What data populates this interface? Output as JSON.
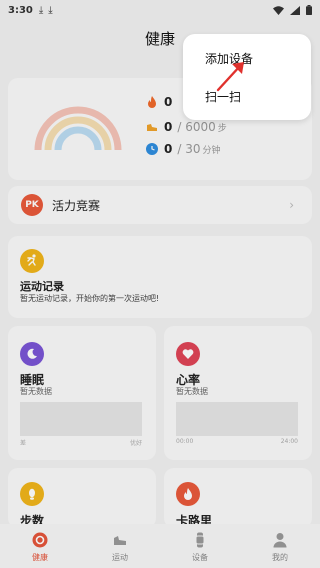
{
  "status_bar": {
    "time": "3:30",
    "download_icons": [
      "download-icon",
      "download-icon"
    ],
    "right_icons": [
      "wifi-icon",
      "signal-icon",
      "battery-icon"
    ]
  },
  "header": {
    "title": "健康"
  },
  "stats": {
    "calories": {
      "value": "0",
      "goal": "",
      "icon": "flame-icon",
      "color": "#f06a2b"
    },
    "steps": {
      "value": "0",
      "goal": "6000",
      "unit": "步",
      "icon": "shoe-icon",
      "color": "#f0a32b"
    },
    "active": {
      "value": "0",
      "goal": "30",
      "unit": "分钟",
      "icon": "clock-icon",
      "color": "#2f8ee0"
    }
  },
  "pk_card": {
    "badge": "PK",
    "label": "活力竞赛",
    "badge_color": "#e95a3b"
  },
  "sport_card": {
    "title": "运动记录",
    "subtitle": "暂无运动记录，开始你的第一次运动吧!",
    "icon": "runner-icon",
    "icon_color": "#f1b51b"
  },
  "sleep_card": {
    "title": "睡眠",
    "subtitle": "暂无数据",
    "axis_left": "差",
    "axis_right": "优好",
    "icon": "moon-icon",
    "icon_color": "#7b55d6"
  },
  "heart_card": {
    "title": "心率",
    "subtitle": "暂无数据",
    "axis_left": "00:00",
    "axis_right": "24:00",
    "icon": "heart-icon",
    "icon_color": "#e04457"
  },
  "steps_card": {
    "title": "步数",
    "icon": "footprint-icon",
    "icon_color": "#f1b51b"
  },
  "calorie_card": {
    "title": "卡路里",
    "icon": "flame-icon",
    "icon_color": "#e95a3b"
  },
  "bottom_nav": [
    {
      "label": "健康",
      "icon": "health-icon",
      "active": true
    },
    {
      "label": "运动",
      "icon": "shoe-icon",
      "active": false
    },
    {
      "label": "设备",
      "icon": "watch-icon",
      "active": false
    },
    {
      "label": "我的",
      "icon": "person-icon",
      "active": false
    }
  ],
  "menu": {
    "items": [
      "添加设备",
      "扫一扫"
    ]
  },
  "colors": {
    "accent": "#e5553b",
    "card": "#fafafa",
    "background": "#f2f2f2"
  }
}
